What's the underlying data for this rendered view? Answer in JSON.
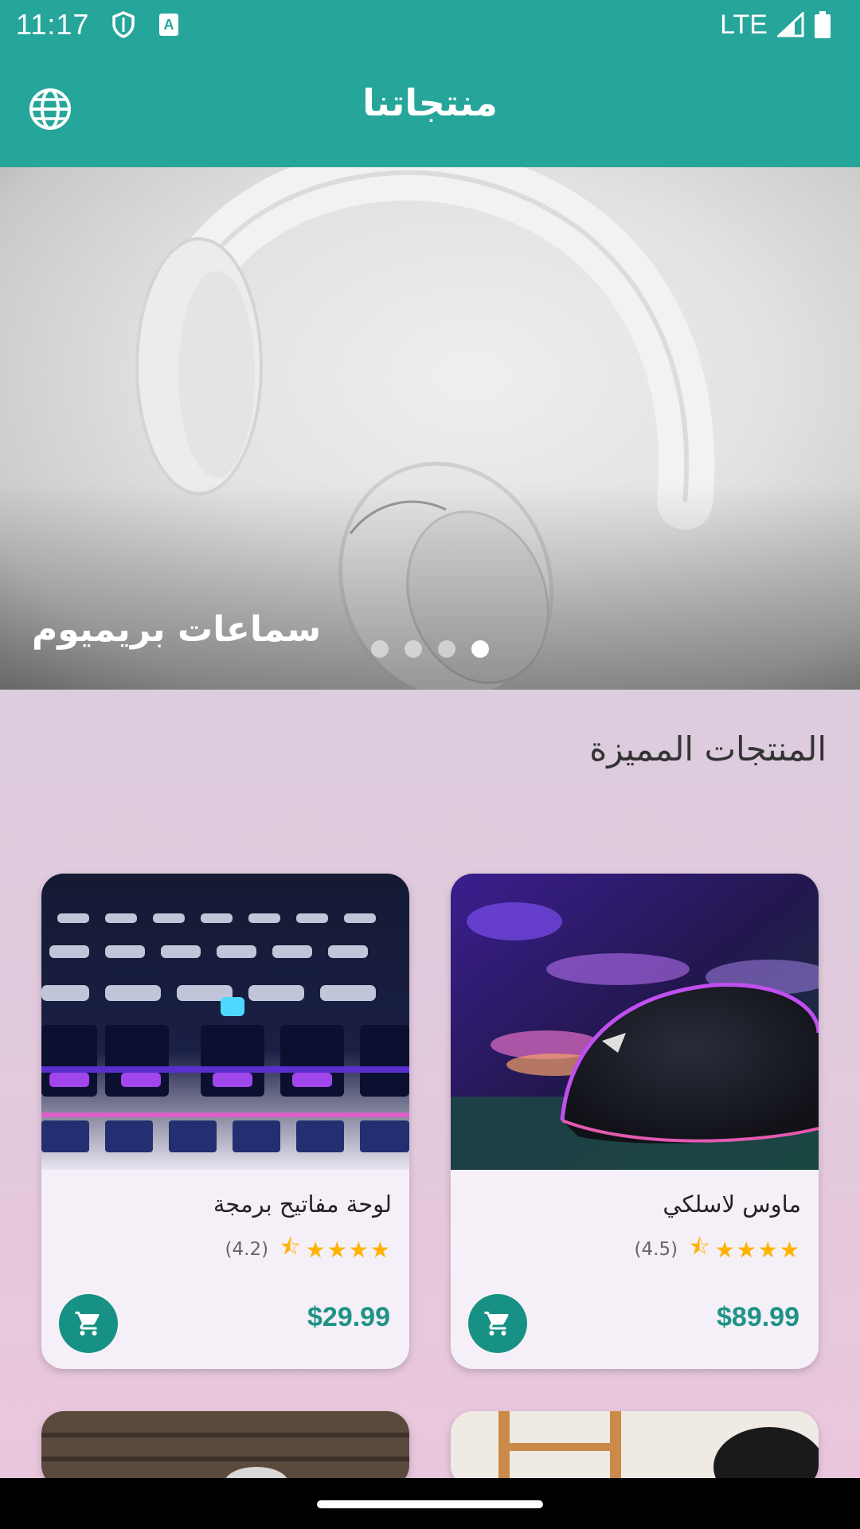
{
  "status_bar": {
    "time": "11:17",
    "network": "LTE",
    "icons": [
      "shield-icon",
      "keyboard-a-icon",
      "signal-icon",
      "battery-icon"
    ]
  },
  "app_bar": {
    "title": "منتجاتنا",
    "language_icon": "globe-icon"
  },
  "banner": {
    "caption": "سماعات بريميوم",
    "slide_count": 4,
    "active_slide": 4
  },
  "section": {
    "title": "المنتجات المميزة"
  },
  "products": [
    {
      "name": "ماوس لاسلكي",
      "rating": 4.5,
      "rating_text": "(4.5)",
      "price": "$89.99",
      "stars": "★★★★",
      "image": "gaming-mouse"
    },
    {
      "name": "لوحة مفاتيح برمجة",
      "rating": 4.2,
      "rating_text": "(4.2)",
      "price": "$29.99",
      "stars": "★★★★",
      "image": "rgb-keyboard"
    }
  ],
  "colors": {
    "primary": "#26a69a",
    "price": "#1e9386",
    "cart_button": "#179183",
    "star": "#ffb300"
  }
}
